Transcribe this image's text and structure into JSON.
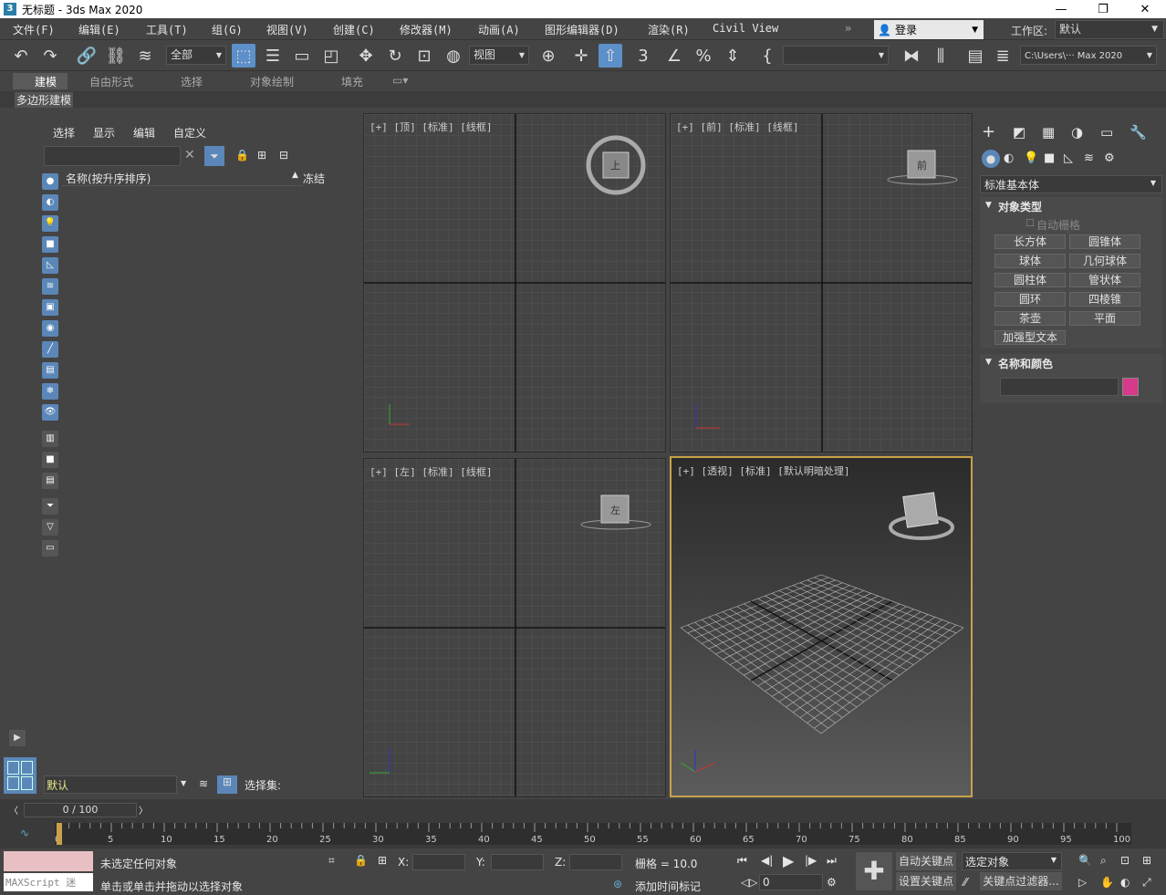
{
  "window": {
    "title": "无标题 - 3ds Max 2020"
  },
  "menus": [
    "文件(F)",
    "编辑(E)",
    "工具(T)",
    "组(G)",
    "视图(V)",
    "创建(C)",
    "修改器(M)",
    "动画(A)",
    "图形编辑器(D)",
    "渲染(R)",
    "Civil View"
  ],
  "login": {
    "label": "登录"
  },
  "workspace": {
    "label": "工作区:",
    "value": "默认"
  },
  "toolbar": {
    "filter_value": "全部",
    "view_value": "视图",
    "path_value": "C:\\Users\\··· Max 2020"
  },
  "ribbon": {
    "tabs": [
      "建模",
      "自由形式",
      "选择",
      "对象绘制",
      "填充"
    ],
    "sub": "多边形建模"
  },
  "scene_explorer": {
    "menus": [
      "选择",
      "显示",
      "编辑",
      "自定义"
    ],
    "col_name": "名称(按升序排序)",
    "col_freeze": "冻结",
    "layer_value": "默认",
    "selection_set_label": "选择集:"
  },
  "viewports": {
    "top": {
      "label": "[+] [顶] [标准] [线框]",
      "cube": "上"
    },
    "front": {
      "label": "[+] [前] [标准] [线框]",
      "cube": "前"
    },
    "left": {
      "label": "[+] [左] [标准] [线框]",
      "cube": "左"
    },
    "persp": {
      "label": "[+] [透视] [标准] [默认明暗处理]"
    }
  },
  "command_panel": {
    "category": "标准基本体",
    "object_type_title": "对象类型",
    "autogrid": "自动栅格",
    "buttons": [
      "长方体",
      "圆锥体",
      "球体",
      "几何球体",
      "圆柱体",
      "管状体",
      "圆环",
      "四棱锥",
      "茶壶",
      "平面",
      "加强型文本"
    ],
    "name_color_title": "名称和颜色",
    "color": "#d63a8a"
  },
  "timeline": {
    "frame": "0 / 100",
    "ticks": [
      "0",
      "5",
      "10",
      "15",
      "20",
      "25",
      "30",
      "35",
      "40",
      "45",
      "50",
      "55",
      "60",
      "65",
      "70",
      "75",
      "80",
      "85",
      "90",
      "95",
      "100"
    ]
  },
  "status": {
    "maxscript": "MAXScript 迷",
    "line1": "未选定任何对象",
    "line2": "单击或单击并拖动以选择对象",
    "x": "X:",
    "y": "Y:",
    "z": "Z:",
    "grid": "栅格 = 10.0",
    "add_time_tag": "添加时间标记",
    "auto_key": "自动关键点",
    "set_key": "设置关键点",
    "selected": "选定对象",
    "key_filters": "关键点过滤器...",
    "frame_value": "0"
  }
}
